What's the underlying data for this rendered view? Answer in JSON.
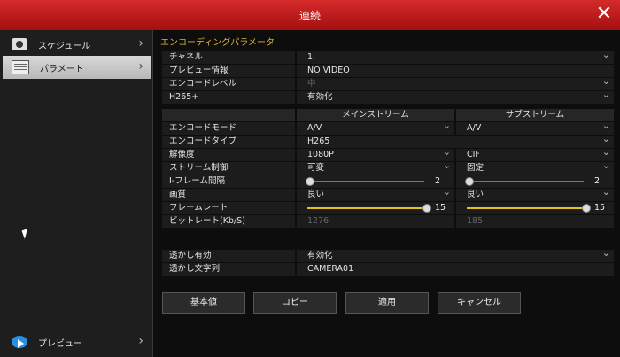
{
  "window": {
    "title": "連続"
  },
  "sidebar": {
    "items": [
      {
        "label": "スケジュール"
      },
      {
        "label": "パラメート"
      },
      {
        "label": "プレビュー"
      }
    ]
  },
  "section_title": "エンコーディングパラメータ",
  "general": {
    "channel_label": "チャネル",
    "channel_value": "1",
    "preview_label": "プレビュー情報",
    "preview_value": "NO VIDEO",
    "level_label": "エンコードレベル",
    "level_value": "中",
    "h265_label": "H265+",
    "h265_value": "有効化"
  },
  "streams": {
    "main_header": "メインストリーム",
    "sub_header": "サブストリーム",
    "rows": [
      {
        "label": "エンコードモード",
        "main": "A/V",
        "sub": "A/V"
      },
      {
        "label": "エンコードタイプ",
        "main": "H265",
        "sub": ""
      },
      {
        "label": "解像度",
        "main": "1080P",
        "sub": "CIF"
      },
      {
        "label": "ストリーム制御",
        "main": "可変",
        "sub": "固定"
      },
      {
        "label": "I-フレーム間隔",
        "main": "2",
        "sub": "2"
      },
      {
        "label": "画質",
        "main": "良い",
        "sub": "良い"
      },
      {
        "label": "フレームレート",
        "main": "15",
        "sub": "15"
      },
      {
        "label": "ビットレート(Kb/S)",
        "main": "1276",
        "sub": "185"
      }
    ],
    "iframe_level": {
      "main": 0,
      "sub": 0
    },
    "framerate_level": {
      "main": 1.0,
      "sub": 1.0
    }
  },
  "watermark": {
    "enable_label": "透かし有効",
    "enable_value": "有効化",
    "text_label": "透かし文字列",
    "text_value": "CAMERA01"
  },
  "buttons": {
    "default": "基本値",
    "copy": "コピー",
    "apply": "適用",
    "cancel": "キャンセル"
  },
  "colors": {
    "title_bar": "#c41a1a",
    "accent": "#e0b23a",
    "slider_fill": "#e8c21c"
  }
}
